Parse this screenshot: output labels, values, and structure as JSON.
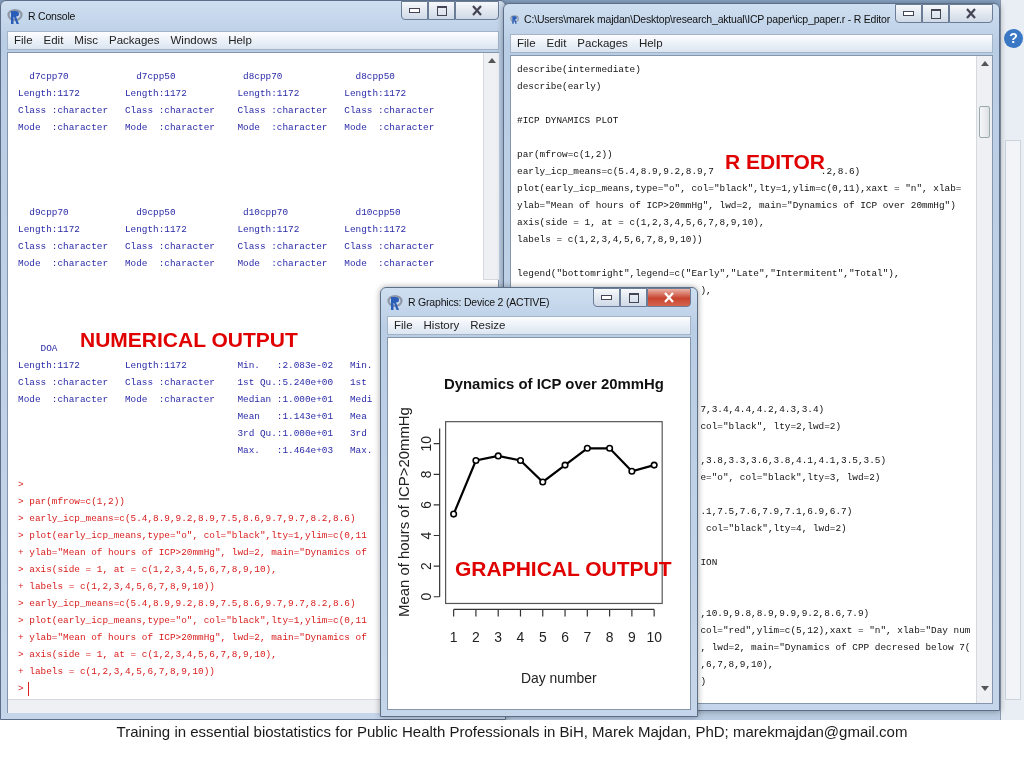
{
  "console": {
    "title": "R Console",
    "active": false,
    "menu": [
      "File",
      "Edit",
      "Misc",
      "Packages",
      "Windows",
      "Help"
    ],
    "annotation": "NUMERICAL OUTPUT",
    "lines": [
      {
        "kind": "output",
        "text": "  d7cpp70            d7cpp50            d8cpp70             d8cpp50"
      },
      {
        "kind": "output",
        "text": "Length:1172        Length:1172         Length:1172        Length:1172"
      },
      {
        "kind": "output",
        "text": "Class :character   Class :character    Class :character   Class :character"
      },
      {
        "kind": "output",
        "text": "Mode  :character   Mode  :character    Mode  :character   Mode  :character"
      },
      {
        "kind": "blank"
      },
      {
        "kind": "blank"
      },
      {
        "kind": "blank"
      },
      {
        "kind": "blank"
      },
      {
        "kind": "output",
        "text": "  d9cpp70            d9cpp50            d10cpp70            d10cpp50"
      },
      {
        "kind": "output",
        "text": "Length:1172        Length:1172         Length:1172        Length:1172"
      },
      {
        "kind": "output",
        "text": "Class :character   Class :character    Class :character   Class :character"
      },
      {
        "kind": "output",
        "text": "Mode  :character   Mode  :character    Mode  :character   Mode  :character"
      },
      {
        "kind": "blank"
      },
      {
        "kind": "blank"
      },
      {
        "kind": "blank"
      },
      {
        "kind": "blank"
      },
      {
        "kind": "output",
        "text": "    DOA"
      },
      {
        "kind": "output",
        "text": "Length:1172        Length:1172         Min.   :2.083e-02   Min."
      },
      {
        "kind": "output",
        "text": "Class :character   Class :character    1st Qu.:5.240e+00   1st"
      },
      {
        "kind": "output",
        "text": "Mode  :character   Mode  :character    Median :1.000e+01   Medi"
      },
      {
        "kind": "output",
        "text": "                                       Mean   :1.143e+01   Mea"
      },
      {
        "kind": "output",
        "text": "                                       3rd Qu.:1.000e+01   3rd"
      },
      {
        "kind": "output",
        "text": "                                       Max.   :1.464e+03   Max."
      },
      {
        "kind": "blank"
      },
      {
        "kind": "command",
        "text": ">"
      },
      {
        "kind": "command",
        "text": "> par(mfrow=c(1,2))"
      },
      {
        "kind": "command",
        "text": "> early_icp_means=c(5.4,8.9,9.2,8.9,7.5,8.6,9.7,9.7,8.2,8.6)"
      },
      {
        "kind": "command",
        "text": "> plot(early_icp_means,type=\"o\", col=\"black\",lty=1,ylim=c(0,11"
      },
      {
        "kind": "command",
        "text": "+ ylab=\"Mean of hours of ICP>20mmHg\", lwd=2, main=\"Dynamics of"
      },
      {
        "kind": "command",
        "text": "> axis(side = 1, at = c(1,2,3,4,5,6,7,8,9,10),"
      },
      {
        "kind": "command",
        "text": "+ labels = c(1,2,3,4,5,6,7,8,9,10))"
      },
      {
        "kind": "command",
        "text": "> early_icp_means=c(5.4,8.9,9.2,8.9,7.5,8.6,9.7,9.7,8.2,8.6)"
      },
      {
        "kind": "command",
        "text": "> plot(early_icp_means,type=\"o\", col=\"black\",lty=1,ylim=c(0,11"
      },
      {
        "kind": "command",
        "text": "+ ylab=\"Mean of hours of ICP>20mmHg\", lwd=2, main=\"Dynamics of"
      },
      {
        "kind": "command",
        "text": "> axis(side = 1, at = c(1,2,3,4,5,6,7,8,9,10),"
      },
      {
        "kind": "command",
        "text": "+ labels = c(1,2,3,4,5,6,7,8,9,10))"
      },
      {
        "kind": "prompt",
        "text": ">"
      }
    ]
  },
  "editor": {
    "title": "C:\\Users\\marek majdan\\Desktop\\research_aktual\\ICP paper\\icp_paper.r - R Editor",
    "active": false,
    "menu": [
      "File",
      "Edit",
      "Packages",
      "Help"
    ],
    "annotation": "R EDITOR",
    "lines": [
      {
        "kind": "code",
        "text": "describe(intermediate)"
      },
      {
        "kind": "code",
        "text": "describe(early)"
      },
      {
        "kind": "blank"
      },
      {
        "kind": "code",
        "text": "#ICP DYNAMICS PLOT"
      },
      {
        "kind": "blank"
      },
      {
        "kind": "code",
        "text": "par(mfrow=c(1,2))"
      },
      {
        "kind": "split",
        "parts": [
          "early_icp_means=c(5.4,8.9,9.2,8.9,7",
          ".2,8.6)"
        ]
      },
      {
        "kind": "code",
        "text": "plot(early_icp_means,type=\"o\", col=\"black\",lty=1,ylim=c(0,11),xaxt = \"n\", xlab="
      },
      {
        "kind": "code",
        "text": "ylab=\"Mean of hours of ICP>20mmHg\", lwd=2, main=\"Dynamics of ICP over 20mmHg\")"
      },
      {
        "kind": "code",
        "text": "axis(side = 1, at = c(1,2,3,4,5,6,7,8,9,10),"
      },
      {
        "kind": "code",
        "text": "labels = c(1,2,3,4,5,6,7,8,9,10))"
      },
      {
        "kind": "blank"
      },
      {
        "kind": "code",
        "text": "legend(\"bottomright\",legend=c(\"Early\",\"Late\",\"Intermitent\",\"Total\"),"
      },
      {
        "kind": "behind",
        "text": "),"
      },
      {
        "kind": "blank"
      },
      {
        "kind": "blank"
      },
      {
        "kind": "blank"
      },
      {
        "kind": "blank"
      },
      {
        "kind": "blank"
      },
      {
        "kind": "blank"
      },
      {
        "kind": "behind",
        "text": "7,3.4,4.4,4.2,4.3,3.4)"
      },
      {
        "kind": "behind",
        "text": "col=\"black\", lty=2,lwd=2)"
      },
      {
        "kind": "blank"
      },
      {
        "kind": "behind",
        "text": ",3.8,3.3,3.6,3.8,4.1,4.1,3.5,3.5)"
      },
      {
        "kind": "behind",
        "text": "e=\"o\", col=\"black\",lty=3, lwd=2)"
      },
      {
        "kind": "blank"
      },
      {
        "kind": "behind",
        "text": ".1,7.5,7.6,7.9,7.1,6.9,6.7)"
      },
      {
        "kind": "behind",
        "text": " col=\"black\",lty=4, lwd=2)"
      },
      {
        "kind": "blank"
      },
      {
        "kind": "behind",
        "text": "ION"
      },
      {
        "kind": "blank"
      },
      {
        "kind": "blank"
      },
      {
        "kind": "behind",
        "text": ",10.9,9.8,8.9,9.9,9.2,8.6,7.9)"
      },
      {
        "kind": "behind",
        "text": "col=\"red\",ylim=c(5,12),xaxt = \"n\", xlab=\"Day num"
      },
      {
        "kind": "behind",
        "text": ", lwd=2, main=\"Dynamics of CPP decresed below 7("
      },
      {
        "kind": "behind",
        "text": ",6,7,8,9,10),"
      },
      {
        "kind": "behind",
        "text": ")"
      }
    ]
  },
  "graphics": {
    "title": "R Graphics: Device 2 (ACTIVE)",
    "active": true,
    "menu": [
      "File",
      "History",
      "Resize"
    ],
    "annotation": "GRAPHICAL OUTPUT",
    "chart_data": {
      "type": "line",
      "title": "Dynamics of ICP over 20mmHg",
      "xlabel": "Day number",
      "ylabel": "Mean of hours of ICP>20mmHg",
      "categories": [
        "1",
        "2",
        "3",
        "4",
        "5",
        "6",
        "7",
        "8",
        "9",
        "10"
      ],
      "series": [
        {
          "color": "#000000",
          "marker": "circle",
          "values": [
            5.4,
            8.9,
            9.2,
            8.9,
            7.5,
            8.6,
            9.7,
            9.7,
            8.2,
            8.6
          ]
        }
      ],
      "ylim": [
        0,
        11
      ],
      "yticks": [
        0,
        2,
        4,
        6,
        8,
        10
      ]
    }
  },
  "side_window": {
    "help": "?"
  },
  "footer": "Training in essential biostatistics for Public Health Professionals in BiH, Marek Majdan, PhD; marekmajdan@gmail.com"
}
